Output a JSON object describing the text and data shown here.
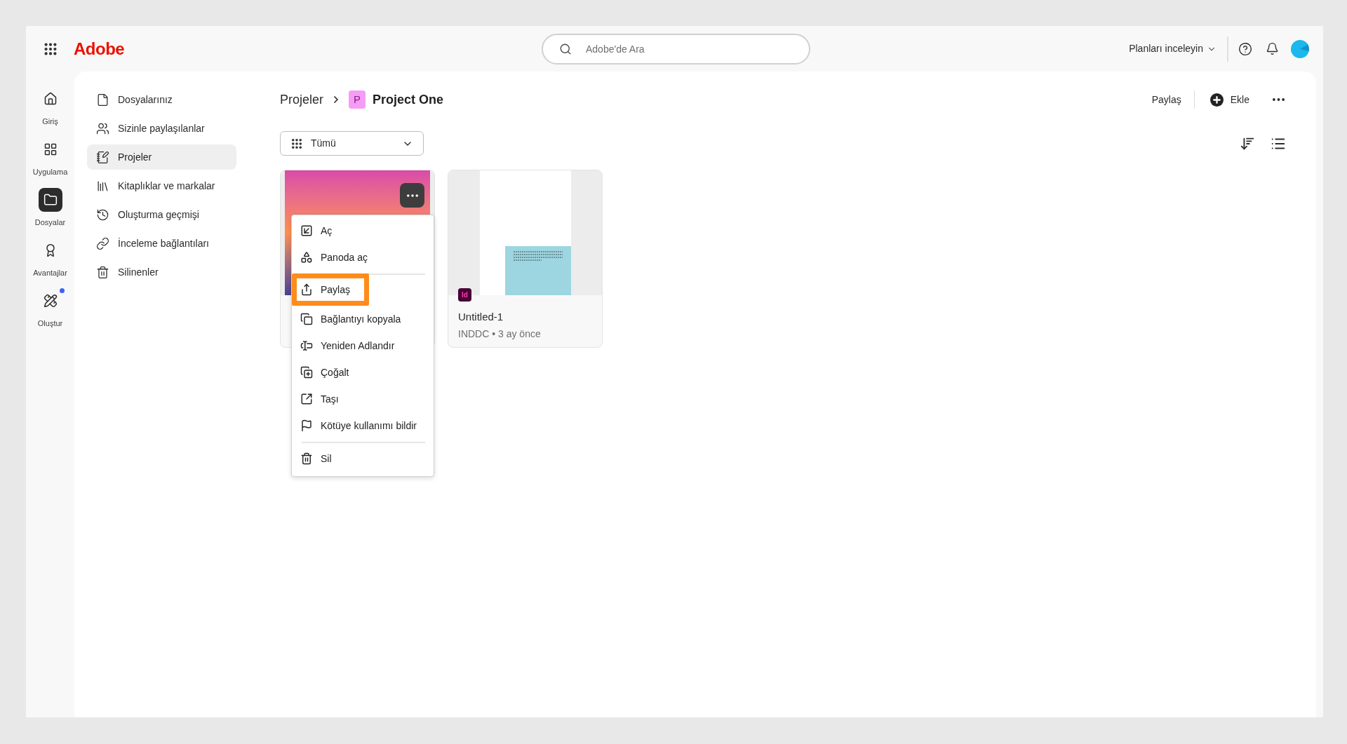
{
  "top_bar": {
    "logo": "Adobe",
    "search": {
      "placeholder": "Adobe'de Ara"
    },
    "plans_menu": "Planları inceleyin"
  },
  "rail": [
    {
      "label": "Giriş",
      "selected": false,
      "notification": false
    },
    {
      "label": "Uygulama",
      "selected": false,
      "notification": false
    },
    {
      "label": "Dosyalar",
      "selected": true,
      "notification": false
    },
    {
      "label": "Avantajlar",
      "selected": false,
      "notification": false
    },
    {
      "label": "Oluştur",
      "selected": false,
      "notification": true
    }
  ],
  "sidebar": {
    "items": [
      {
        "label": "Dosyalarınız",
        "selected": false
      },
      {
        "label": "Sizinle paylaşılanlar",
        "selected": false
      },
      {
        "label": "Projeler",
        "selected": true
      },
      {
        "label": "Kitaplıklar ve markalar",
        "selected": false
      },
      {
        "label": "Oluşturma geçmişi",
        "selected": false
      },
      {
        "label": "İnceleme bağlantıları",
        "selected": false
      },
      {
        "label": "Silinenler",
        "selected": false
      }
    ]
  },
  "breadcrumb": {
    "parent": "Projeler",
    "project_initial": "P",
    "current": "Project One"
  },
  "toolbar": {
    "share": "Paylaş",
    "add": "Ekle"
  },
  "filter": {
    "value": "Tümü"
  },
  "cards": [
    {
      "kind": "image",
      "hovered": true,
      "menu": {
        "items": [
          {
            "kind": "item",
            "label": "Aç",
            "highlighted": false
          },
          {
            "kind": "item",
            "label": "Panoda aç",
            "highlighted": false
          },
          {
            "kind": "divider"
          },
          {
            "kind": "item",
            "label": "Paylaş",
            "highlighted": true
          },
          {
            "kind": "item",
            "label": "Bağlantıyı kopyala",
            "highlighted": false
          },
          {
            "kind": "item",
            "label": "Yeniden Adlandır",
            "highlighted": false
          },
          {
            "kind": "item",
            "label": "Çoğalt",
            "highlighted": false
          },
          {
            "kind": "item",
            "label": "Taşı",
            "highlighted": false
          },
          {
            "kind": "item",
            "label": "Kötüye kullanımı bildir",
            "highlighted": false
          },
          {
            "kind": "divider"
          },
          {
            "kind": "item",
            "label": "Sil",
            "highlighted": false
          }
        ]
      }
    },
    {
      "kind": "document",
      "hovered": false,
      "app_badge": "Id",
      "title": "Untitled-1",
      "meta": "INDDC • 3 ay önce"
    }
  ]
}
